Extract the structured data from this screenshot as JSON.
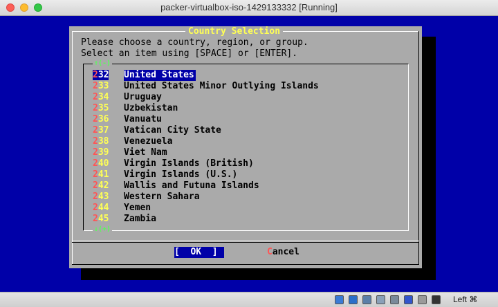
{
  "window": {
    "title": "packer-virtualbox-iso-1429133332 [Running]"
  },
  "dialog": {
    "title": "Country Selection",
    "instructions": [
      "Please choose a country, region, or group.",
      "Select an item using [SPACE] or [ENTER]."
    ],
    "scroll_up_marker": "↑(-)",
    "scroll_down_marker": "↓(+)",
    "items": [
      {
        "num": "232",
        "label": "United States",
        "selected": true
      },
      {
        "num": "233",
        "label": "United States Minor Outlying Islands"
      },
      {
        "num": "234",
        "label": "Uruguay"
      },
      {
        "num": "235",
        "label": "Uzbekistan"
      },
      {
        "num": "236",
        "label": "Vanuatu"
      },
      {
        "num": "237",
        "label": "Vatican City State"
      },
      {
        "num": "238",
        "label": "Venezuela"
      },
      {
        "num": "239",
        "label": "Viet Nam"
      },
      {
        "num": "240",
        "label": "Virgin Islands (British)"
      },
      {
        "num": "241",
        "label": "Virgin Islands (U.S.)"
      },
      {
        "num": "242",
        "label": "Wallis and Futuna Islands"
      },
      {
        "num": "243",
        "label": "Western Sahara"
      },
      {
        "num": "244",
        "label": "Yemen"
      },
      {
        "num": "245",
        "label": "Zambia"
      }
    ],
    "ok_button": "[  OK  ]",
    "cancel_button": "Cancel"
  },
  "statusbar": {
    "host_key": "Left ⌘",
    "icons": [
      "disk-icon",
      "optical-drive-icon",
      "network-icon",
      "shared-folder-icon",
      "usb-icon",
      "vm-icon",
      "mouse-integration-icon",
      "keyboard-capture-icon"
    ]
  },
  "colors": {
    "background": "#0000a8",
    "dialog": "#aaaaaa",
    "highlight": "#0000a8",
    "title_text": "#ffff55",
    "number_first_digit": "#ff5555",
    "number_digits": "#ffff55"
  }
}
